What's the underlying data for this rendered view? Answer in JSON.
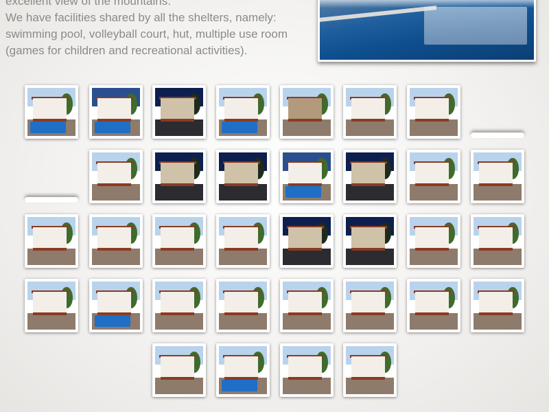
{
  "intro": {
    "line1": "excellent view of the mountains.",
    "line2": "We have facilities shared by all the shelters, namely: swimming pool, volleyball court, hut, multiple use room (games for children and recreational activities)."
  },
  "thumbnails": [
    {
      "scene": "day-pool"
    },
    {
      "scene": "dusk-pool"
    },
    {
      "scene": "night"
    },
    {
      "scene": "day-pool"
    },
    {
      "scene": "stone"
    },
    {
      "scene": "day"
    },
    {
      "scene": "day"
    },
    {
      "scene": "day"
    },
    {
      "scene": "night"
    },
    {
      "scene": "night"
    },
    {
      "scene": "dusk-pool"
    },
    {
      "scene": "night"
    },
    {
      "scene": "day"
    },
    {
      "scene": "day"
    },
    {
      "scene": "day"
    },
    {
      "scene": "day"
    },
    {
      "scene": "day"
    },
    {
      "scene": "day"
    },
    {
      "scene": "night"
    },
    {
      "scene": "night"
    },
    {
      "scene": "day"
    },
    {
      "scene": "day"
    },
    {
      "scene": "day"
    },
    {
      "scene": "day-pool"
    },
    {
      "scene": "day"
    },
    {
      "scene": "day"
    },
    {
      "scene": "day"
    },
    {
      "scene": "day"
    },
    {
      "scene": "day"
    },
    {
      "scene": "day"
    },
    {
      "scene": "day"
    },
    {
      "scene": "day-pool"
    },
    {
      "scene": "day"
    },
    {
      "scene": "day"
    }
  ],
  "colors": {
    "sky_day": "#b9d3ec",
    "sky_dusk": "#2a4f8f",
    "sky_night": "#0d1f4f",
    "ground_day": "#8e7b6b",
    "ground_night": "#2b2b30",
    "building": "#f3efe8",
    "roof": "#8a3b22",
    "pool": "#1f6fc6"
  }
}
